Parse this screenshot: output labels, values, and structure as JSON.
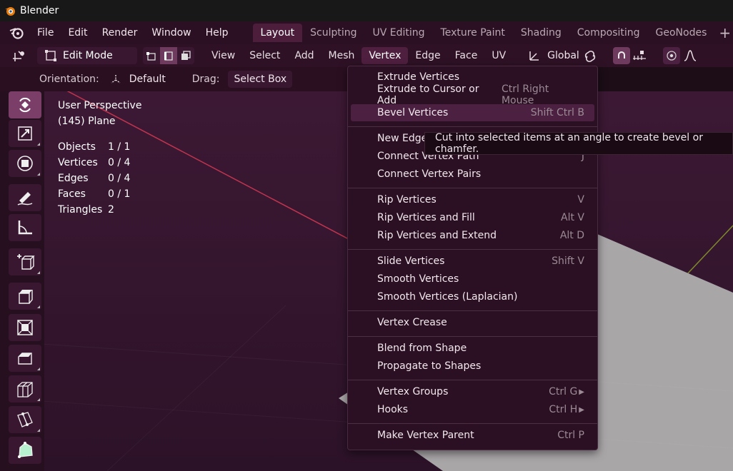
{
  "window": {
    "title": "Blender"
  },
  "menubar": {
    "items": [
      "File",
      "Edit",
      "Render",
      "Window",
      "Help"
    ],
    "tabs": [
      "Layout",
      "Sculpting",
      "UV Editing",
      "Texture Paint",
      "Shading",
      "Compositing",
      "GeoNodes"
    ],
    "active_tab": "Layout"
  },
  "toolbar": {
    "mode": "Edit Mode",
    "menus": [
      "View",
      "Select",
      "Add",
      "Mesh",
      "Vertex",
      "Edge",
      "Face",
      "UV"
    ],
    "open_menu": "Vertex",
    "transform_orientation": "Global"
  },
  "options": {
    "orientation_label": "Orientation:",
    "orientation_value": "Default",
    "drag_label": "Drag:",
    "drag_value": "Select Box"
  },
  "viewport": {
    "view_name": "User Perspective",
    "object_name": "(145) Plane",
    "stats": [
      {
        "label": "Objects",
        "value": "1 / 1"
      },
      {
        "label": "Vertices",
        "value": "0 / 4"
      },
      {
        "label": "Edges",
        "value": "0 / 4"
      },
      {
        "label": "Faces",
        "value": "0 / 1"
      },
      {
        "label": "Triangles",
        "value": "2"
      }
    ]
  },
  "vertex_menu": {
    "items": [
      {
        "label": "Extrude Vertices",
        "shortcut": ""
      },
      {
        "label": "Extrude to Cursor or Add",
        "shortcut": "Ctrl Right Mouse"
      },
      {
        "label": "Bevel Vertices",
        "shortcut": "Shift Ctrl B"
      },
      {
        "label": "New Edge",
        "shortcut": ""
      },
      {
        "label": "Connect Vertex Path",
        "shortcut": "J"
      },
      {
        "label": "Connect Vertex Pairs",
        "shortcut": ""
      },
      {
        "label": "Rip Vertices",
        "shortcut": "V"
      },
      {
        "label": "Rip Vertices and Fill",
        "shortcut": "Alt V"
      },
      {
        "label": "Rip Vertices and Extend",
        "shortcut": "Alt D"
      },
      {
        "label": "Slide Vertices",
        "shortcut": "Shift V"
      },
      {
        "label": "Smooth Vertices",
        "shortcut": ""
      },
      {
        "label": "Smooth Vertices (Laplacian)",
        "shortcut": ""
      },
      {
        "label": "Vertex Crease",
        "shortcut": ""
      },
      {
        "label": "Blend from Shape",
        "shortcut": ""
      },
      {
        "label": "Propagate to Shapes",
        "shortcut": ""
      },
      {
        "label": "Vertex Groups",
        "shortcut": "Ctrl G"
      },
      {
        "label": "Hooks",
        "shortcut": "Ctrl H"
      },
      {
        "label": "Make Vertex Parent",
        "shortcut": "Ctrl P"
      }
    ],
    "highlighted": "Bevel Vertices"
  },
  "tooltip": {
    "text": "Cut into selected items at an angle to create bevel or chamfer."
  }
}
